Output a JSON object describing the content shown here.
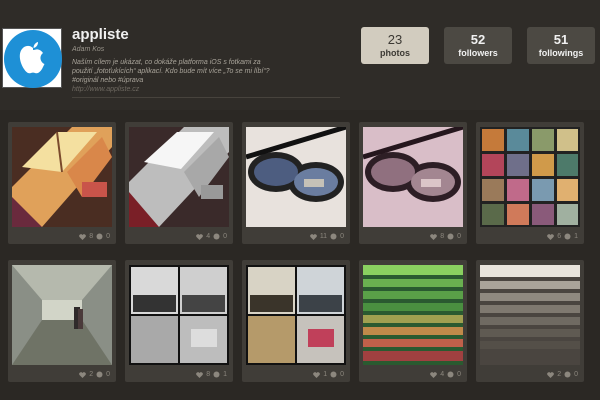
{
  "profile": {
    "name": "appliste",
    "author": "Adam Kos",
    "bio": "Naším cílem je ukázat, co dokáže platforma iOS s fotkami za použití „fotoťukících“ aplikací. Kdo bude mít více „To se mi líbí“? #originál nebo #úprava",
    "url": "http://www.appliste.cz"
  },
  "stats": [
    {
      "value": "23",
      "label": "photos"
    },
    {
      "value": "52",
      "label": "followers"
    },
    {
      "value": "51",
      "label": "followings"
    }
  ],
  "photos": [
    {
      "likes": "8",
      "comments": "0",
      "subject": "interior-light"
    },
    {
      "likes": "4",
      "comments": "0",
      "subject": "interior-light-bw"
    },
    {
      "likes": "11",
      "comments": "0",
      "subject": "sunglasses"
    },
    {
      "likes": "8",
      "comments": "0",
      "subject": "sunglasses-alt"
    },
    {
      "likes": "6",
      "comments": "1",
      "subject": "collage-grid"
    },
    {
      "likes": "2",
      "comments": "0",
      "subject": "tunnel"
    },
    {
      "likes": "8",
      "comments": "1",
      "subject": "collage-bw"
    },
    {
      "likes": "1",
      "comments": "0",
      "subject": "collage-color"
    },
    {
      "likes": "4",
      "comments": "0",
      "subject": "stairs-green"
    },
    {
      "likes": "2",
      "comments": "0",
      "subject": "stairs-gray"
    }
  ],
  "colors": {
    "background": "#2b2824",
    "tile": "#403d38",
    "stat": "#4c4943",
    "stat_active": "#d2ccbf",
    "brand": "#1e90d6"
  }
}
